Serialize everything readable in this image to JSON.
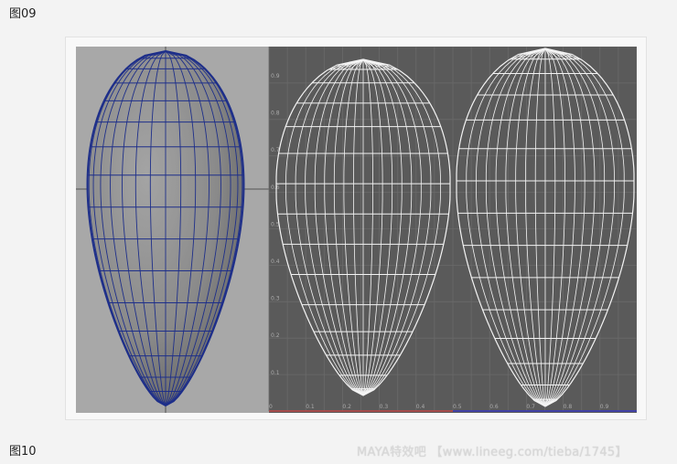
{
  "captions": {
    "figure_top": "图09",
    "figure_bottom": "图10"
  },
  "watermark": "MAYA特效吧 【www.lineeg.com/tieba/1745】",
  "uv_editor": {
    "v_ticks": [
      "0.9",
      "0.8",
      "0.7",
      "0.6",
      "0.5",
      "0.4",
      "0.3",
      "0.2",
      "0.1"
    ],
    "u_ticks": [
      "0",
      "0.1",
      "0.2",
      "0.3",
      "0.4",
      "0.5",
      "0.6",
      "0.7",
      "0.8",
      "0.9"
    ]
  },
  "colors": {
    "perspective_bg": "#a8a8a8",
    "mesh_fill": "#8e8e8e",
    "mesh_wire": "#1e2f8a",
    "uv_bg": "#5a5a5a",
    "uv_grid": "#6a6a6a",
    "uv_wire": "#f4f4f4",
    "axis_red": "#c04848",
    "axis_blue": "#3a3ac0"
  }
}
